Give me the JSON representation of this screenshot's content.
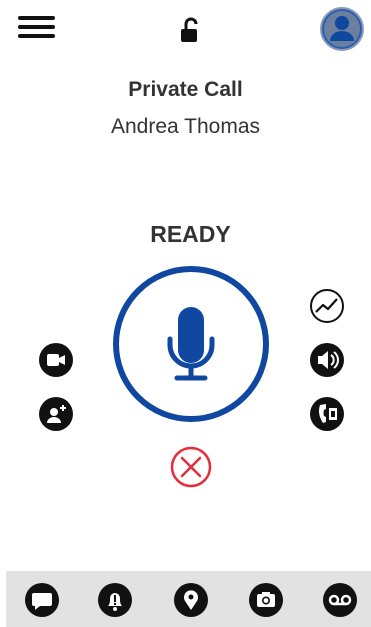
{
  "header": {
    "menu_icon": "hamburger-menu-icon",
    "lock_icon": "unlocked-padlock-icon",
    "avatar_icon": "user-avatar-icon",
    "accent_color": "#1e4da1"
  },
  "call": {
    "type_label": "Private Call",
    "contact_name": "Andrea Thomas",
    "status": "READY"
  },
  "ptt": {
    "icon": "microphone-icon",
    "ring_color": "#0f47a1"
  },
  "left_actions": [
    {
      "icon": "video-camera-icon"
    },
    {
      "icon": "add-user-icon"
    }
  ],
  "right_actions": [
    {
      "icon": "activity-chart-icon"
    },
    {
      "icon": "speaker-icon"
    },
    {
      "icon": "phone-call-icon"
    }
  ],
  "end_call": {
    "icon": "close-circle-icon",
    "color": "#e52d3b"
  },
  "bottom_nav": [
    {
      "icon": "message-icon"
    },
    {
      "icon": "alert-bell-icon"
    },
    {
      "icon": "location-pin-icon"
    },
    {
      "icon": "camera-icon"
    },
    {
      "icon": "voicemail-icon"
    }
  ]
}
